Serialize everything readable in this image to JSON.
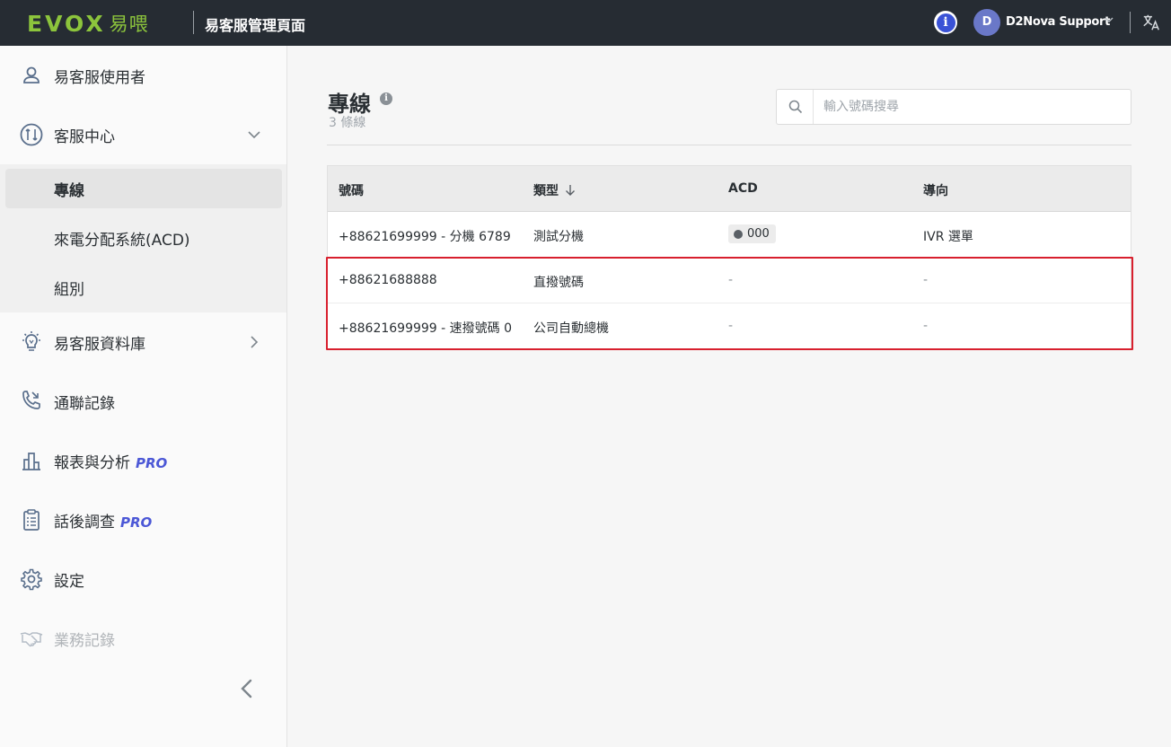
{
  "header": {
    "logo_word": "EVOX",
    "logo_cn": "易喂",
    "app_title": "易客服管理頁面",
    "avatar_initial": "D",
    "user_name": "D2Nova Support",
    "icons": {
      "info": "info-icon",
      "caret": "chevron-down-icon",
      "language": "translate-icon"
    },
    "colors": {
      "bar": "#262c33",
      "logo": "#8cc43c",
      "info": "#3a52d6",
      "avatar": "#6a78c8"
    }
  },
  "sidebar": {
    "items": [
      {
        "label": "易客服使用者",
        "icon": "user-icon"
      },
      {
        "label": "客服中心",
        "icon": "call-center-icon",
        "expanded": true
      },
      {
        "label": "易客服資料庫",
        "icon": "lightbulb-icon"
      },
      {
        "label": "通聯記錄",
        "icon": "call-log-icon"
      },
      {
        "label": "報表與分析",
        "pro": "PRO",
        "icon": "bar-chart-icon"
      },
      {
        "label": "話後調查",
        "pro": "PRO",
        "icon": "clipboard-icon"
      },
      {
        "label": "設定",
        "icon": "gear-icon"
      },
      {
        "label": "業務記錄",
        "icon": "handshake-icon",
        "disabled": true
      }
    ],
    "sub_items": [
      {
        "label": "專線",
        "active": true
      },
      {
        "label": "來電分配系統(ACD)"
      },
      {
        "label": "組別"
      }
    ],
    "collapse_icon": "chevron-left-icon"
  },
  "main": {
    "title": "專線",
    "count_text": "3 條線",
    "search": {
      "placeholder": "輸入號碼搜尋",
      "value": ""
    },
    "table": {
      "headers": [
        "號碼",
        "類型",
        "ACD",
        "導向"
      ],
      "sorted_column": "類型",
      "sort_direction": "descending",
      "rows": [
        {
          "number": "+88621699999 - 分機 6789",
          "type": "測試分機",
          "acd": "000",
          "route": "IVR 選單"
        },
        {
          "number": "+88621688888",
          "type": "直撥號碼",
          "acd": "-",
          "route": "-"
        },
        {
          "number": "+88621699999 - 速撥號碼 0",
          "type": "公司自動總機",
          "acd": "-",
          "route": "-"
        }
      ]
    },
    "highlight_color": "#d8202e"
  }
}
